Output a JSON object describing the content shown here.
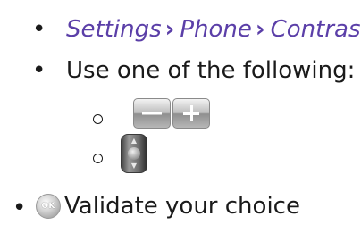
{
  "path": {
    "items": [
      "Settings",
      "Phone",
      "Contrast"
    ],
    "separator": "›"
  },
  "instructions": {
    "use_line": "Use one of the following:",
    "validate_text": "Validate your choice"
  },
  "keys": {
    "ok_label": "OK",
    "nav_up_arrow": "▲",
    "nav_down_arrow": "▼"
  },
  "colors": {
    "accent": "#5b3fa8",
    "text": "#1a1a1a"
  }
}
